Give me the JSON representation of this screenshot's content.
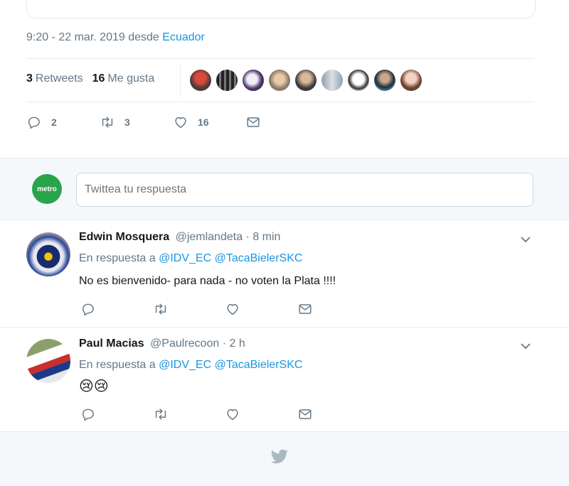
{
  "tweet": {
    "time": "9:20 - 22 mar. 2019",
    "from_word": "desde",
    "place": "Ecuador",
    "retweets_count": "3",
    "retweets_label": "Retweets",
    "likes_count": "16",
    "likes_label": "Me gusta",
    "actions": {
      "reply_count": "2",
      "retweet_count": "3",
      "like_count": "16"
    }
  },
  "liked_by_avatars": [
    "avatar-1",
    "avatar-2",
    "avatar-3",
    "avatar-4",
    "avatar-5",
    "avatar-6",
    "avatar-7",
    "avatar-8",
    "avatar-9"
  ],
  "reply_box": {
    "avatar_text": "metro",
    "placeholder": "Twittea tu respuesta"
  },
  "replies": [
    {
      "name": "Edwin Mosquera",
      "handle": "@jemlandeta",
      "time": "· 8 min",
      "reply_prefix": "En respuesta a",
      "reply_to_1": "@IDV_EC",
      "reply_to_2": "@TacaBielerSKC",
      "text": "No es bienvenido- para nada - no voten la Plata !!!!"
    },
    {
      "name": "Paul Macias",
      "handle": "@Paulrecoon",
      "time": "· 2 h",
      "reply_prefix": "En respuesta a",
      "reply_to_1": "@IDV_EC",
      "reply_to_2": "@TacaBielerSKC",
      "text": "😢😢"
    }
  ],
  "colors": {
    "link": "#1b95e0",
    "muted": "#657786",
    "text": "#14171a",
    "bg_light": "#f5f8fa",
    "border": "#e6ecf0"
  }
}
